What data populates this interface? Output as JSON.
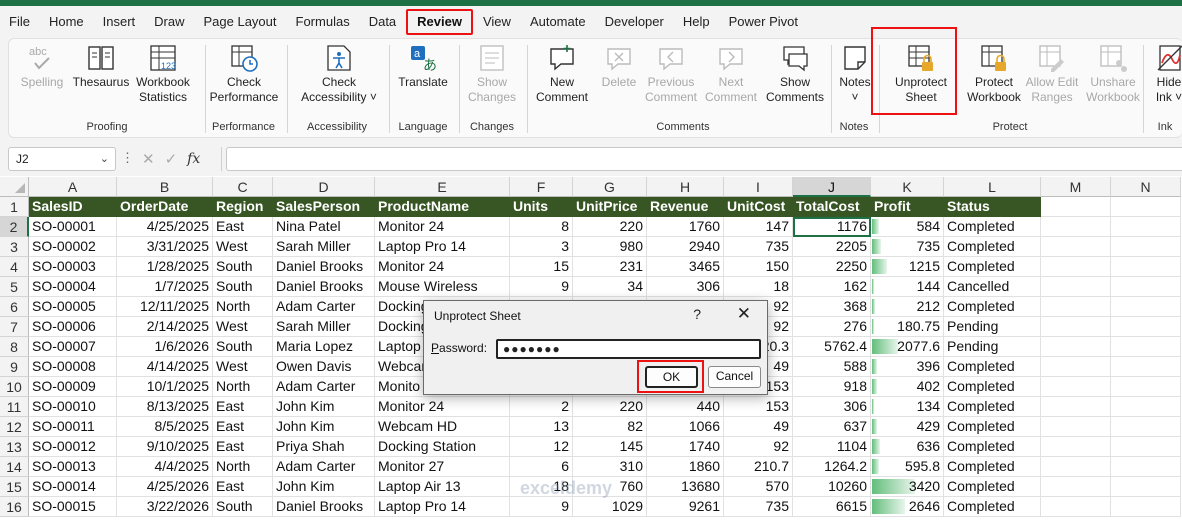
{
  "menu": {
    "items": [
      "File",
      "Home",
      "Insert",
      "Draw",
      "Page Layout",
      "Formulas",
      "Data",
      "Review",
      "View",
      "Automate",
      "Developer",
      "Help",
      "Power Pivot"
    ],
    "active": "Review"
  },
  "ribbon": {
    "proofing": {
      "label": "Proofing",
      "spelling": "Spelling",
      "thesaurus": "Thesaurus",
      "workbook_stats_1": "Workbook",
      "workbook_stats_2": "Statistics"
    },
    "performance": {
      "label": "Performance",
      "check_1": "Check",
      "check_2": "Performance"
    },
    "accessibility": {
      "label": "Accessibility",
      "check_1": "Check",
      "check_2": "Accessibility ˅"
    },
    "language": {
      "label": "Language",
      "translate": "Translate"
    },
    "changes": {
      "label": "Changes",
      "show_1": "Show",
      "show_2": "Changes"
    },
    "comments": {
      "label": "Comments",
      "new_1": "New",
      "new_2": "Comment",
      "delete": "Delete",
      "prev_1": "Previous",
      "prev_2": "Comment",
      "next_1": "Next",
      "next_2": "Comment",
      "show_1": "Show",
      "show_2": "Comments"
    },
    "notes": {
      "label": "Notes",
      "notes": "Notes"
    },
    "protect": {
      "label": "Protect",
      "unprotect_1": "Unprotect",
      "unprotect_2": "Sheet",
      "protect_wb_1": "Protect",
      "protect_wb_2": "Workbook",
      "allow_1": "Allow Edit",
      "allow_2": "Ranges",
      "unshare_1": "Unshare",
      "unshare_2": "Workbook"
    },
    "ink": {
      "label": "Ink",
      "hide_1": "Hide",
      "hide_2": "Ink ˅"
    }
  },
  "formula_bar": {
    "name_box": "J2",
    "fx": "fx",
    "formula": ""
  },
  "grid": {
    "columns": [
      "A",
      "B",
      "C",
      "D",
      "E",
      "F",
      "G",
      "H",
      "I",
      "J",
      "K",
      "L",
      "M",
      "N"
    ],
    "selected_column": "J",
    "selected_row": "2",
    "header": [
      "SalesID",
      "OrderDate",
      "Region",
      "SalesPerson",
      "ProductName",
      "Units",
      "UnitPrice",
      "Revenue",
      "UnitCost",
      "TotalCost",
      "Profit",
      "Status"
    ],
    "rows": [
      [
        "2",
        "SO-00001",
        "4/25/2025",
        "East",
        "Nina Patel",
        "Monitor 24",
        "8",
        "220",
        "1760",
        "147",
        "1176",
        "584",
        "Completed"
      ],
      [
        "3",
        "SO-00002",
        "3/31/2025",
        "West",
        "Sarah Miller",
        "Laptop Pro 14",
        "3",
        "980",
        "2940",
        "735",
        "2205",
        "735",
        "Completed"
      ],
      [
        "4",
        "SO-00003",
        "1/28/2025",
        "South",
        "Daniel Brooks",
        "Monitor 24",
        "15",
        "231",
        "3465",
        "150",
        "2250",
        "1215",
        "Completed"
      ],
      [
        "5",
        "SO-00004",
        "1/7/2025",
        "South",
        "Daniel Brooks",
        "Mouse Wireless",
        "9",
        "34",
        "306",
        "18",
        "162",
        "144",
        "Cancelled"
      ],
      [
        "6",
        "SO-00005",
        "12/11/2025",
        "North",
        "Adam Carter",
        "Docking",
        "",
        "",
        "",
        "92",
        "368",
        "212",
        "Completed"
      ],
      [
        "7",
        "SO-00006",
        "2/14/2025",
        "West",
        "Sarah Miller",
        "Docking",
        "",
        "",
        "",
        "92",
        "276",
        "180.75",
        "Pending"
      ],
      [
        "8",
        "SO-00007",
        "1/6/2026",
        "South",
        "Maria Lopez",
        "Laptop",
        "",
        "",
        "",
        "20.3",
        "5762.4",
        "2077.6",
        "Pending"
      ],
      [
        "9",
        "SO-00008",
        "4/14/2025",
        "West",
        "Owen Davis",
        "Webcar",
        "",
        "",
        "",
        "49",
        "588",
        "396",
        "Completed"
      ],
      [
        "10",
        "SO-00009",
        "10/1/2025",
        "North",
        "Adam Carter",
        "Monito",
        "",
        "",
        "",
        "153",
        "918",
        "402",
        "Completed"
      ],
      [
        "11",
        "SO-00010",
        "8/13/2025",
        "East",
        "John Kim",
        "Monitor 24",
        "2",
        "220",
        "440",
        "153",
        "306",
        "134",
        "Completed"
      ],
      [
        "12",
        "SO-00011",
        "8/5/2025",
        "East",
        "John Kim",
        "Webcam HD",
        "13",
        "82",
        "1066",
        "49",
        "637",
        "429",
        "Completed"
      ],
      [
        "13",
        "SO-00012",
        "9/10/2025",
        "East",
        "Priya Shah",
        "Docking Station",
        "12",
        "145",
        "1740",
        "92",
        "1104",
        "636",
        "Completed"
      ],
      [
        "14",
        "SO-00013",
        "4/4/2025",
        "North",
        "Adam Carter",
        "Monitor 27",
        "6",
        "310",
        "1860",
        "210.7",
        "1264.2",
        "595.8",
        "Completed"
      ],
      [
        "15",
        "SO-00014",
        "4/25/2026",
        "East",
        "John Kim",
        "Laptop Air 13",
        "18",
        "760",
        "13680",
        "570",
        "10260",
        "3420",
        "Completed"
      ],
      [
        "16",
        "SO-00015",
        "3/22/2026",
        "South",
        "Daniel Brooks",
        "Laptop Pro 14",
        "9",
        "1029",
        "9261",
        "735",
        "6615",
        "2646",
        "Completed"
      ]
    ],
    "profit_max": 3420
  },
  "dialog": {
    "title": "Unprotect Sheet",
    "help": "?",
    "close": "✕",
    "password_label_u": "P",
    "password_label_rest": "assword:",
    "password_value": "●●●●●●●",
    "ok": "OK",
    "cancel": "Cancel"
  },
  "watermark": "exceldemy",
  "colors": {
    "excel_green": "#1e7145",
    "header_fill": "#375623",
    "highlight_red": "#ee1111",
    "databar_green": "#63be7b"
  }
}
